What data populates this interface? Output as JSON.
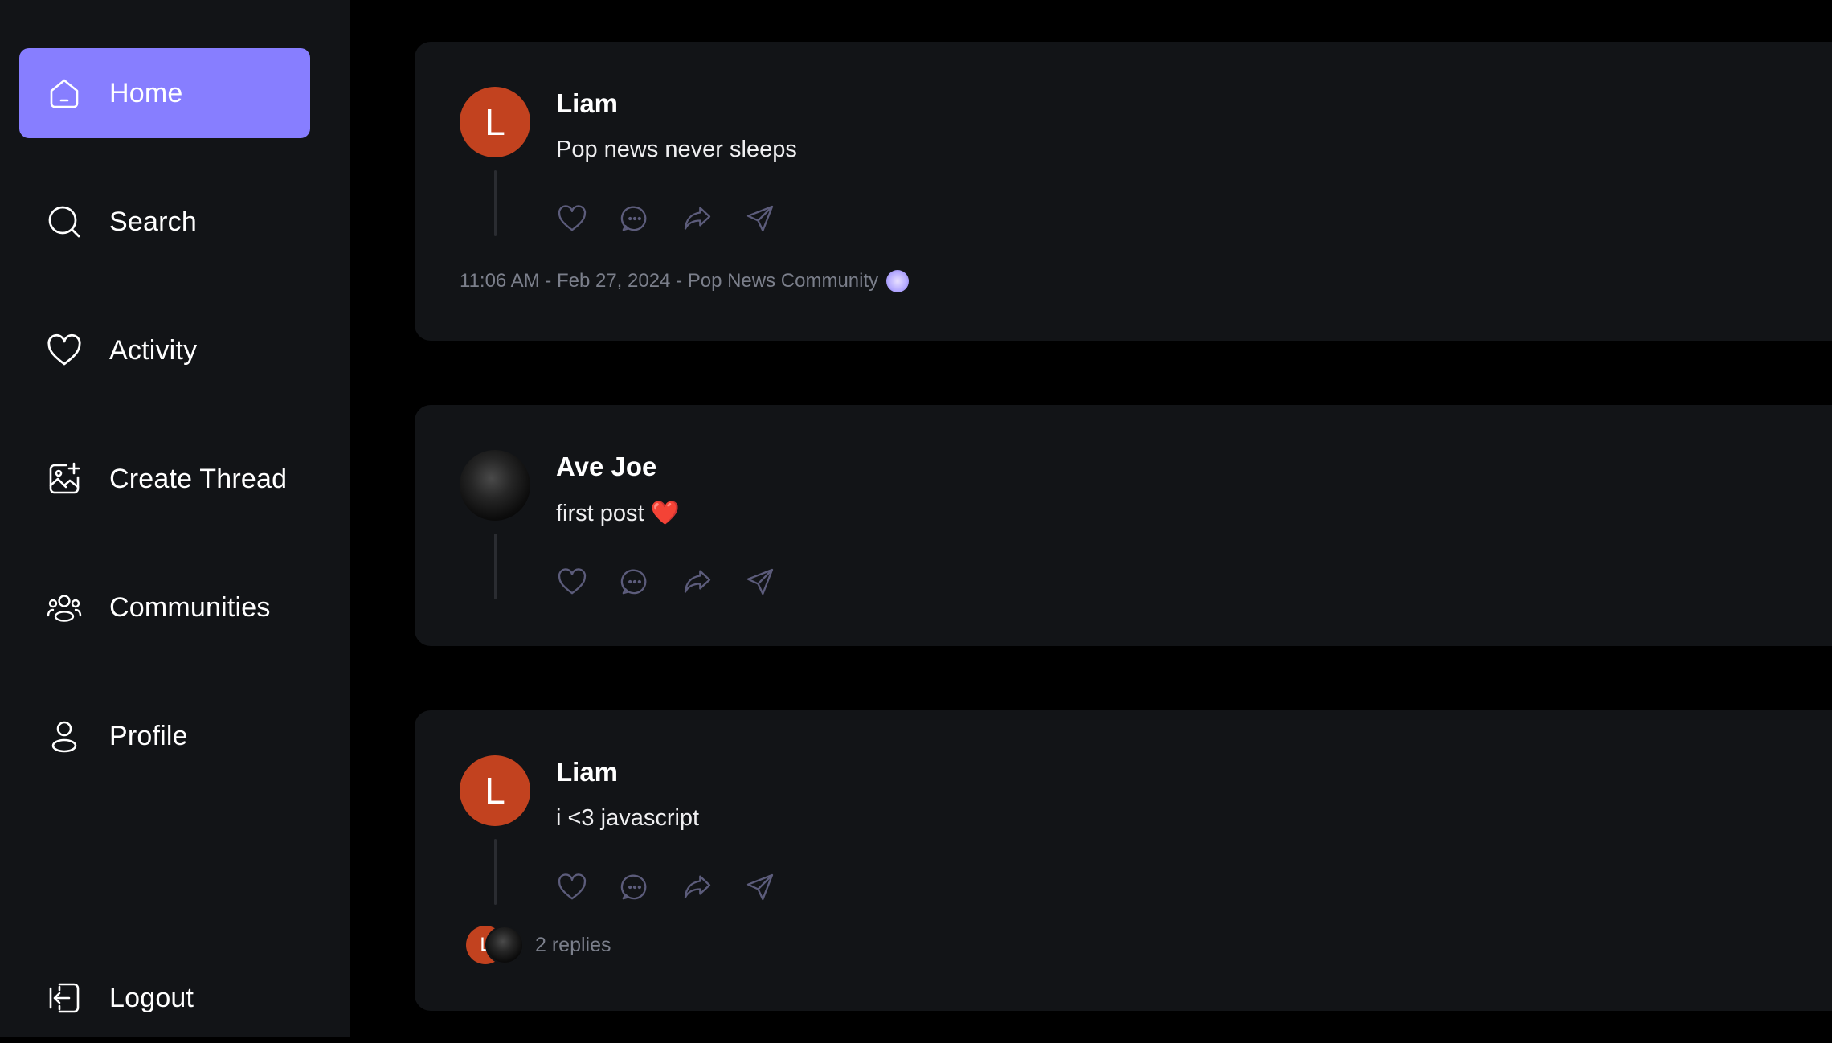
{
  "sidebar": {
    "items": [
      {
        "label": "Home",
        "icon": "home-icon",
        "active": true
      },
      {
        "label": "Search",
        "icon": "search-icon"
      },
      {
        "label": "Activity",
        "icon": "heart-icon"
      },
      {
        "label": "Create Thread",
        "icon": "image-plus-icon"
      },
      {
        "label": "Communities",
        "icon": "users-icon"
      },
      {
        "label": "Profile",
        "icon": "user-icon"
      }
    ],
    "logout": {
      "label": "Logout",
      "icon": "logout-icon"
    }
  },
  "colors": {
    "accent": "#877eff",
    "card_bg": "#121417",
    "page_bg": "#000000",
    "avatar_letter_bg": "#c2421f",
    "muted_text": "#7b7f8b"
  },
  "threads": [
    {
      "avatar_letter": "L",
      "author": "Liam",
      "content": "Pop news never sleeps",
      "meta": "11:06 AM - Feb 27, 2024 - Pop News Community"
    },
    {
      "author": "Ave Joe",
      "content": "first post ❤️"
    },
    {
      "avatar_letter": "L",
      "author": "Liam",
      "content": "i <3 javascript",
      "reply_avatar_letter": "L",
      "replies": "2 replies"
    }
  ]
}
